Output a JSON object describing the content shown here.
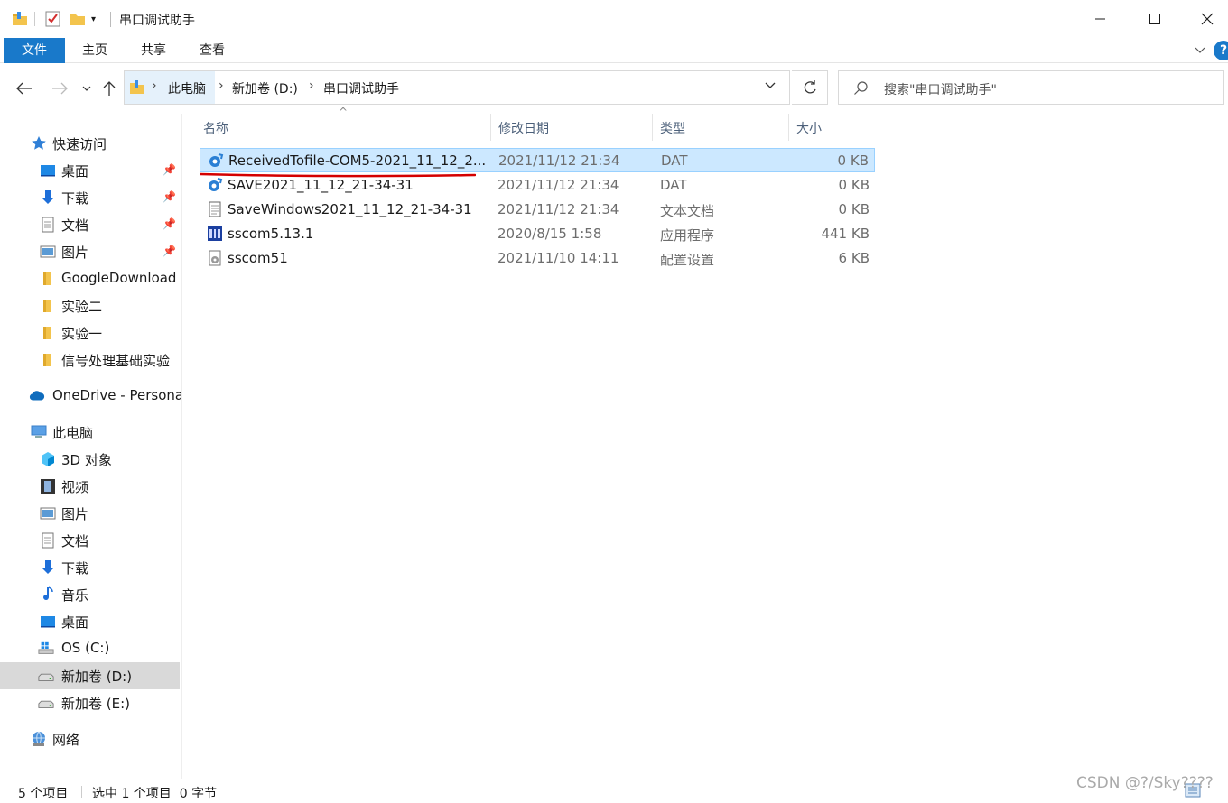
{
  "window": {
    "title": "串口调试助手",
    "minimize_label": "—",
    "maximize_label": "☐",
    "close_label": "✕"
  },
  "ribbon": {
    "tabs": [
      "文件",
      "主页",
      "共享",
      "查看"
    ],
    "help_label": "?"
  },
  "address": {
    "crumbs": [
      "此电脑",
      "新加卷 (D:)",
      "串口调试助手"
    ]
  },
  "search": {
    "placeholder": "搜索\"串口调试助手\""
  },
  "sidebar": {
    "quick_access": "快速访问",
    "quick_items": [
      "桌面",
      "下载",
      "文档",
      "图片",
      "GoogleDownload",
      "实验二",
      "实验一",
      "信号处理基础实验"
    ],
    "onedrive": "OneDrive - Persona",
    "this_pc": "此电脑",
    "pc_items": [
      "3D 对象",
      "视频",
      "图片",
      "文档",
      "下载",
      "音乐",
      "桌面",
      "OS (C:)",
      "新加卷 (D:)",
      "新加卷 (E:)"
    ],
    "network": "网络"
  },
  "columns": {
    "name": "名称",
    "date": "修改日期",
    "type": "类型",
    "size": "大小"
  },
  "files": [
    {
      "name": "ReceivedTofile-COM5-2021_11_12_2...",
      "date": "2021/11/12 21:34",
      "type": "DAT",
      "size": "0 KB",
      "icon": "dat-file-icon"
    },
    {
      "name": "SAVE2021_11_12_21-34-31",
      "date": "2021/11/12 21:34",
      "type": "DAT",
      "size": "0 KB",
      "icon": "dat-file-icon"
    },
    {
      "name": "SaveWindows2021_11_12_21-34-31",
      "date": "2021/11/12 21:34",
      "type": "文本文档",
      "size": "0 KB",
      "icon": "text-file-icon"
    },
    {
      "name": "sscom5.13.1",
      "date": "2020/8/15 1:58",
      "type": "应用程序",
      "size": "441 KB",
      "icon": "application-icon"
    },
    {
      "name": "sscom51",
      "date": "2021/11/10 14:11",
      "type": "配置设置",
      "size": "6 KB",
      "icon": "config-file-icon"
    }
  ],
  "status": {
    "count": "5 个项目",
    "selected": "选中 1 个项目  0 字节"
  },
  "watermark": "CSDN @?/Sky????",
  "colors": {
    "accent": "#1979ca",
    "selection": "#cce8ff",
    "annotation_red": "#d40000"
  }
}
